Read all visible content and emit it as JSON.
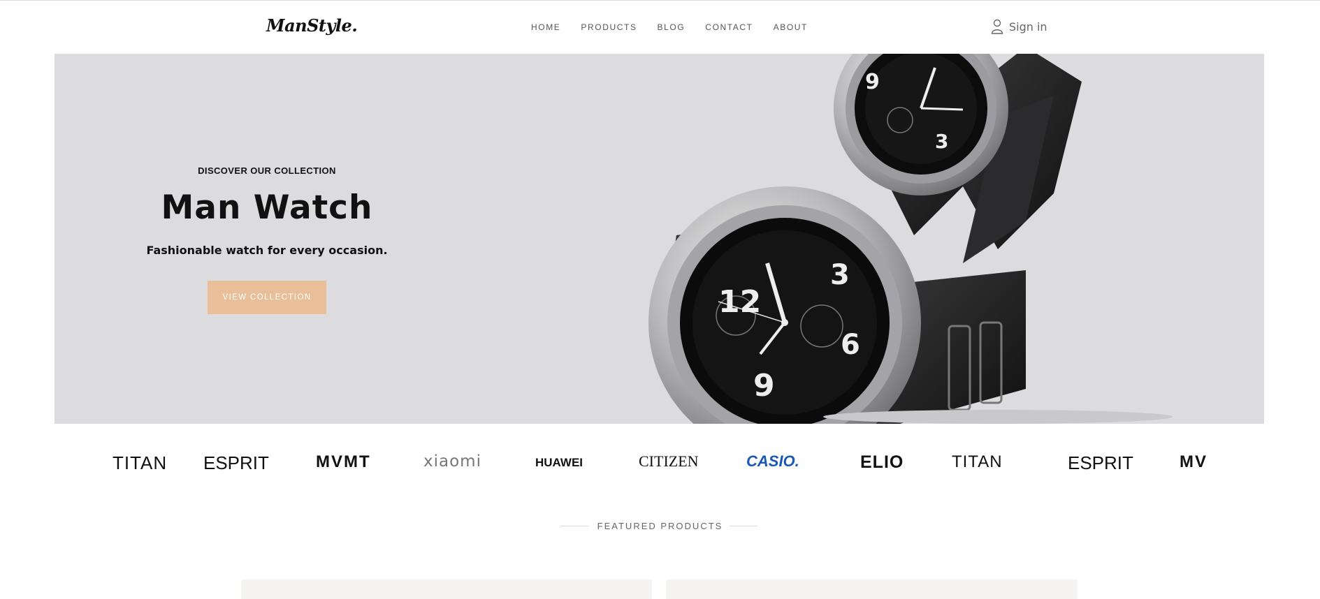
{
  "header": {
    "logo": "ManStyle.",
    "nav": [
      "HOME",
      "PRODUCTS",
      "BLOG",
      "CONTACT",
      "ABOUT"
    ],
    "signin_label": "Sign in"
  },
  "hero": {
    "eyebrow": "DISCOVER OUR COLLECTION",
    "title": "Man Watch",
    "subtitle": "Fashionable watch for every occasion.",
    "button_label": "VIEW COLLECTION",
    "background_color": "#dcdcde",
    "button_color": "#e8bf98"
  },
  "brands": [
    "TITAN",
    "ESPRIT",
    "MVMT",
    "xiaomi",
    "HUAWEI",
    "CITIZEN",
    "CASIO.",
    "ELIO",
    "TITAN",
    "ESPRIT",
    "MVMT"
  ],
  "featured": {
    "label": "FEATURED PRODUCTS"
  }
}
